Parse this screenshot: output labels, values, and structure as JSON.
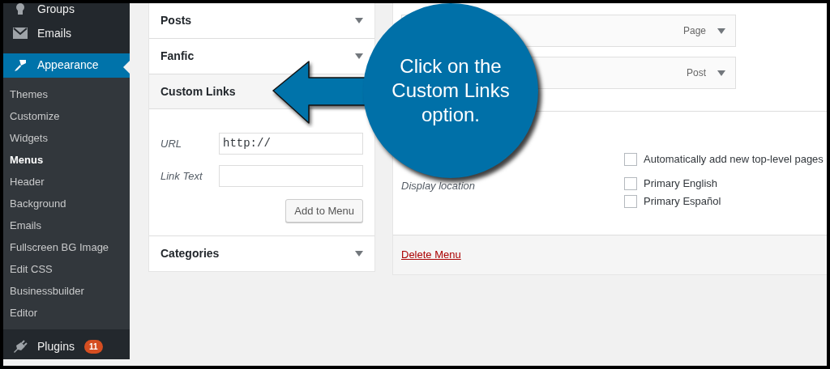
{
  "sidebar": {
    "top_items": [
      {
        "label": "Groups",
        "kind": "groups",
        "selected": false
      },
      {
        "label": "Emails",
        "kind": "emails",
        "selected": false
      },
      {
        "label": "Appearance",
        "kind": "appearance",
        "selected": true
      }
    ],
    "submenu": [
      {
        "label": "Themes",
        "selected": false
      },
      {
        "label": "Customize",
        "selected": false
      },
      {
        "label": "Widgets",
        "selected": false
      },
      {
        "label": "Menus",
        "selected": true
      },
      {
        "label": "Header",
        "selected": false
      },
      {
        "label": "Background",
        "selected": false
      },
      {
        "label": "Emails",
        "selected": false
      },
      {
        "label": "Fullscreen BG Image",
        "selected": false
      },
      {
        "label": "Edit CSS",
        "selected": false
      },
      {
        "label": "Businessbuilder",
        "selected": false
      },
      {
        "label": "Editor",
        "selected": false
      }
    ],
    "bottom_items": [
      {
        "label": "Plugins",
        "kind": "plugins",
        "badge": "11",
        "selected": false
      }
    ]
  },
  "sections": [
    {
      "title": "Posts",
      "expanded": false
    },
    {
      "title": "Fanfic",
      "expanded": false
    },
    {
      "title": "Custom Links",
      "expanded": true,
      "url_label": "URL",
      "url_value": "http://",
      "link_text_label": "Link Text",
      "button": "Add to Menu"
    },
    {
      "title": "Categories",
      "expanded": false
    }
  ],
  "menu_items": [
    {
      "type": "Page"
    },
    {
      "type": "Post"
    }
  ],
  "settings": {
    "auto_add": {
      "label": "Automatically add new top-level pages",
      "checked": false
    },
    "display_location": "Display location",
    "locations": [
      {
        "label": "Primary English",
        "checked": false
      },
      {
        "label": "Primary Español",
        "checked": false
      }
    ]
  },
  "delete_link": "Delete Menu",
  "callout": "Click on the Custom Links option."
}
